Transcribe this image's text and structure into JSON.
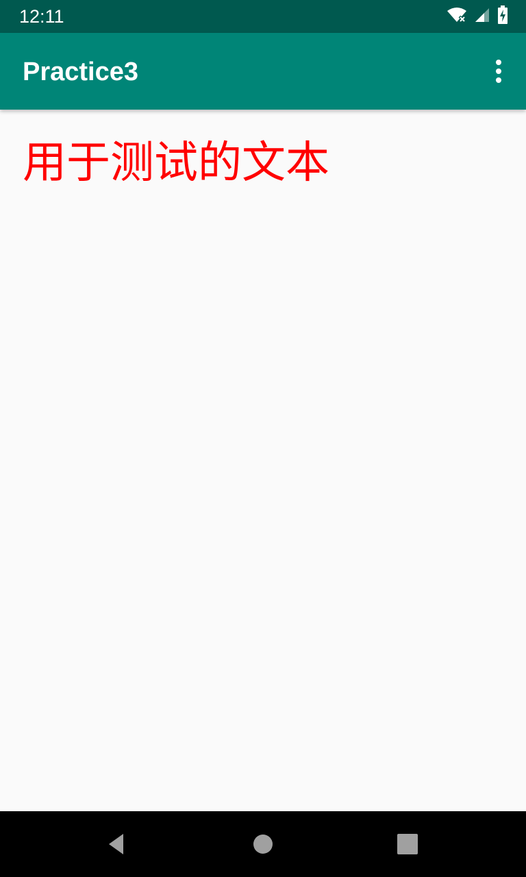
{
  "status_bar": {
    "time": "12:11",
    "icons": [
      "wifi-no-internet-icon",
      "cell-signal-icon",
      "battery-charging-icon"
    ]
  },
  "app_bar": {
    "title": "Practice3",
    "overflow_icon": "more-vert-icon"
  },
  "content": {
    "text": "用于测试的文本",
    "text_color": "#ff0000"
  },
  "nav_bar": {
    "buttons": [
      "back-icon",
      "home-icon",
      "recents-icon"
    ]
  },
  "colors": {
    "status_bar": "#00594f",
    "app_bar": "#008577",
    "background": "#fafafa",
    "nav_bar": "#000000"
  }
}
